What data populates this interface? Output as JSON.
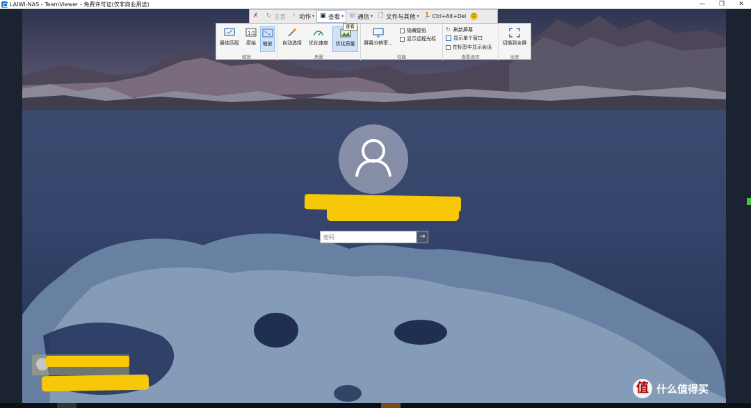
{
  "window": {
    "title": "LAIWI-NAS - TeamViewer - 免费许可证(仅非商业用途)",
    "controls": [
      "—",
      "❐",
      "✕"
    ]
  },
  "toolbar": {
    "home": "主页",
    "actions": "动作",
    "view": "查看",
    "communicate": "通信",
    "files": "文件与其他",
    "ctrl_alt_del": "Ctrl+Alt+Del",
    "tooltip": "查看"
  },
  "ribbon": {
    "scale": {
      "label": "缩放",
      "buttons": [
        "最佳匹配",
        "原始",
        "缩放"
      ],
      "selected": "缩放"
    },
    "quality": {
      "label": "质量",
      "buttons": [
        "自动选择",
        "优化速度",
        "优化质量"
      ],
      "selected": "优化质量"
    },
    "performance": {
      "label": "性能",
      "resolution": "屏幕分辨率...",
      "hide_wallpaper": "隐藏壁纸",
      "show_remote_cursor": "显示远程光标"
    },
    "view_options": {
      "label": "查看选项",
      "refresh": "刷新屏幕",
      "single_window": "显示单个窗口",
      "session_in_tabs": "在标签中显示会话"
    },
    "fullscreen": {
      "label": "全屏",
      "toggle": "切换到全屏"
    }
  },
  "login": {
    "password_placeholder": "密码",
    "submit_arrow": "→"
  },
  "watermark": {
    "logo": "值",
    "text": "什么值得买"
  }
}
